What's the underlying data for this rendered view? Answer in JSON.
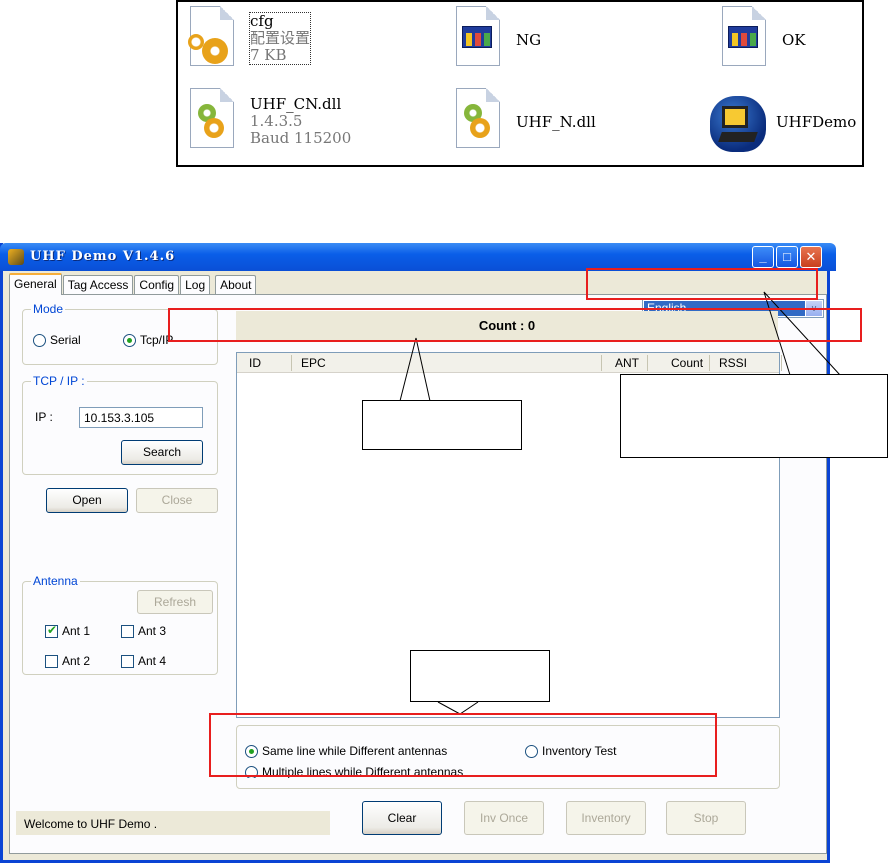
{
  "files": [
    {
      "name": "cfg",
      "line2": "配置设置",
      "line3": "7 KB",
      "icon": "config-file-icon"
    },
    {
      "name": "NG",
      "icon": "window-image-icon"
    },
    {
      "name": "OK",
      "icon": "window-image-icon"
    },
    {
      "name": "UHF_CN.dll",
      "line2": "1.4.3.5",
      "line3": "Baud 115200",
      "icon": "dll-file-icon"
    },
    {
      "name": "UHF_N.dll",
      "icon": "dll-file-icon"
    },
    {
      "name": "UHFDemo",
      "icon": "application-icon"
    }
  ],
  "window": {
    "title": "UHF Demo V1.4.6",
    "controls": {
      "minimize": "_",
      "maximize": "□",
      "close": "✕"
    }
  },
  "tabs": [
    "General",
    "Tag Access",
    "Config",
    "Log",
    "About"
  ],
  "mode": {
    "legend": "Mode",
    "options": [
      "Serial",
      "Tcp/IP"
    ],
    "selected": "Tcp/IP"
  },
  "tcp": {
    "legend": "TCP / IP :",
    "ip_label": "IP :",
    "ip_value": "10.153.3.105",
    "search_label": "Search"
  },
  "connection": {
    "open_label": "Open",
    "close_label": "Close"
  },
  "antenna": {
    "legend": "Antenna",
    "refresh_label": "Refresh",
    "items": [
      {
        "label": "Ant 1",
        "checked": true
      },
      {
        "label": "Ant 3",
        "checked": false
      },
      {
        "label": "Ant 2",
        "checked": false
      },
      {
        "label": "Ant 4",
        "checked": false
      }
    ]
  },
  "language": {
    "selected": "English",
    "arrow": "v"
  },
  "count": {
    "text": "Count : 0"
  },
  "table": {
    "columns": [
      "ID",
      "EPC",
      "ANT",
      "Count",
      "RSSI"
    ]
  },
  "options": {
    "same_line": "Same line while Different antennas",
    "multiple_lines": "Multiple lines while Different antennas",
    "inventory_test": "Inventory Test"
  },
  "status": {
    "text": "Welcome to UHF Demo ."
  },
  "actions": {
    "clear_label": "Clear",
    "inv_once_label": "Inv Once",
    "inventory_label": "Inventory",
    "stop_label": "Stop"
  },
  "colors": {
    "title_blue": "#0a5ee8",
    "annotation_red": "#e81e1e",
    "selection_blue": "#316ac5"
  }
}
